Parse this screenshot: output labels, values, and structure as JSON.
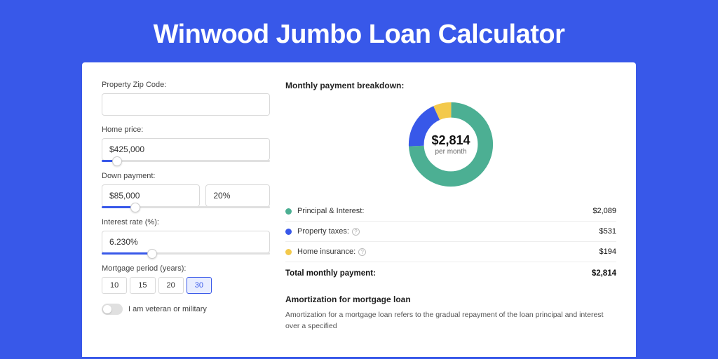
{
  "title": "Winwood Jumbo Loan Calculator",
  "form": {
    "zip_label": "Property Zip Code:",
    "zip_value": "",
    "home_price_label": "Home price:",
    "home_price_value": "$425,000",
    "down_payment_label": "Down payment:",
    "down_payment_value": "$85,000",
    "down_payment_pct": "20%",
    "interest_label": "Interest rate (%):",
    "interest_value": "6.230%",
    "period_label": "Mortgage period (years):",
    "period_options": [
      "10",
      "15",
      "20",
      "30"
    ],
    "period_selected": "30",
    "veteran_label": "I am veteran or military"
  },
  "breakdown": {
    "title": "Monthly payment breakdown:",
    "center_amount": "$2,814",
    "center_sub": "per month",
    "items": [
      {
        "label": "Principal & Interest:",
        "value": "$2,089",
        "color": "#4caf93",
        "info": false
      },
      {
        "label": "Property taxes:",
        "value": "$531",
        "color": "#3858e9",
        "info": true
      },
      {
        "label": "Home insurance:",
        "value": "$194",
        "color": "#f3c94b",
        "info": true
      }
    ],
    "total_label": "Total monthly payment:",
    "total_value": "$2,814"
  },
  "amortization": {
    "title": "Amortization for mortgage loan",
    "text": "Amortization for a mortgage loan refers to the gradual repayment of the loan principal and interest over a specified"
  },
  "chart_data": {
    "type": "pie",
    "title": "Monthly payment breakdown",
    "series": [
      {
        "name": "Principal & Interest",
        "value": 2089,
        "color": "#4caf93"
      },
      {
        "name": "Property taxes",
        "value": 531,
        "color": "#3858e9"
      },
      {
        "name": "Home insurance",
        "value": 194,
        "color": "#f3c94b"
      }
    ],
    "total": 2814
  }
}
